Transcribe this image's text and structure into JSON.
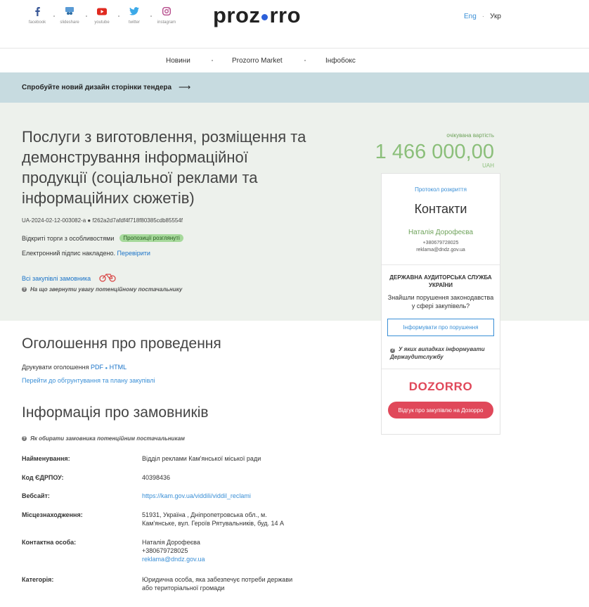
{
  "header": {
    "social": [
      {
        "label": "facebook",
        "icon": "facebook-icon"
      },
      {
        "label": "slideshare",
        "icon": "slideshare-icon"
      },
      {
        "label": "youtube",
        "icon": "youtube-icon"
      },
      {
        "label": "twitter",
        "icon": "twitter-icon"
      },
      {
        "label": "instagram",
        "icon": "instagram-icon"
      }
    ],
    "logo_left": "proz",
    "logo_right": "rro",
    "lang_en": "Eng",
    "lang_sep": "·",
    "lang_uk": "Укр"
  },
  "nav": {
    "items": [
      "Новини",
      "Prozorro Market",
      "Інфобокс"
    ]
  },
  "banner": {
    "text": "Спробуйте новий дизайн сторінки тендера",
    "arrow": "⟶"
  },
  "tender": {
    "title": "Послуги з виготовлення, розміщення та демонстрування інформаційної продукції (соціальної реклами та інформаційних сюжетів)",
    "id_line": "UA-2024-02-12-003082-a ● f262a2d7afdf4f718f80385cdb85554f",
    "procedure": "Відкриті торги з особливостями",
    "status_badge": "Пропозиції розглянуті",
    "sign_text": "Електронний підпис накладено.",
    "sign_link": "Перевірити",
    "all_purchases": "Всі закупівлі замовника",
    "hint": "На що звернути увагу потенційному постачальнику",
    "cost_label": "очікувана вартість",
    "cost_value": "1 466 000,00",
    "currency": "UAH"
  },
  "card": {
    "protocol": "Протокол розкриття",
    "contacts_title": "Контакти",
    "person": "Наталія Дорофеєва",
    "phone": "+380679728025",
    "email": "reklama@dndz.gov.ua",
    "audit_title": "ДЕРЖАВНА АУДИТОРСЬКА СЛУЖБА УКРАЇНИ",
    "audit_question": "Знайшли порушення законодавства у сфері закупівель?",
    "inform_button": "Інформувати про порушення",
    "when_hint": "У яких випадках інформувати Держаудитслужбу",
    "dozorro_logo": "DOZORRO",
    "review_button": "Відгук про закупівлю на Дозорро"
  },
  "announcement": {
    "heading": "Оголошення про проведення",
    "print_label": "Друкувати оголошення",
    "pdf": "PDF",
    "sep": "●",
    "html": "HTML",
    "justify_link": "Перейти до обгрунтування та плану закупівлі"
  },
  "customers": {
    "heading": "Інформація про замовників",
    "hint": "Як обирати замовника потенційним постачальникам",
    "rows": [
      {
        "key": "Найменування:",
        "value": "Відділ реклами Кам'янської міської ради"
      },
      {
        "key": "Код ЄДРПОУ:",
        "value": "40398436"
      },
      {
        "key": "Вебсайт:",
        "value": "https://kam.gov.ua/viddili/viddil_reclami"
      },
      {
        "key": "Місцезнаходження:",
        "value": "51931, Україна , Дніпропетровська обл., м. Кам'янське, вул. Героїв Рятувальників, буд. 14 А"
      },
      {
        "key": "Контактна особа:",
        "value": "Наталія Дорофеєва",
        "value2": "+380679728025",
        "value3": "reklama@dndz.gov.ua"
      },
      {
        "key": "Категорія:",
        "value": "Юридична особа, яка забезпечує потреби держави або територіальної громади"
      }
    ]
  }
}
